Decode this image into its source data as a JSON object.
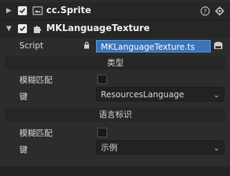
{
  "components": [
    {
      "title": "cc.Sprite",
      "enabled": true
    },
    {
      "title": "MKLanguageTexture",
      "enabled": true
    }
  ],
  "script": {
    "label": "Script",
    "value": "MKLanguageTexture.ts"
  },
  "section1": {
    "header": "类型",
    "fuzzy_label": "模糊匹配",
    "key_label": "键",
    "key_value": "ResourcesLanguage"
  },
  "section2": {
    "header": "语言标识",
    "fuzzy_label": "模糊匹配",
    "key_label": "键",
    "key_value": "示例"
  },
  "colors": {
    "accent": "#3a74b6",
    "panel": "#2c2c2c"
  }
}
